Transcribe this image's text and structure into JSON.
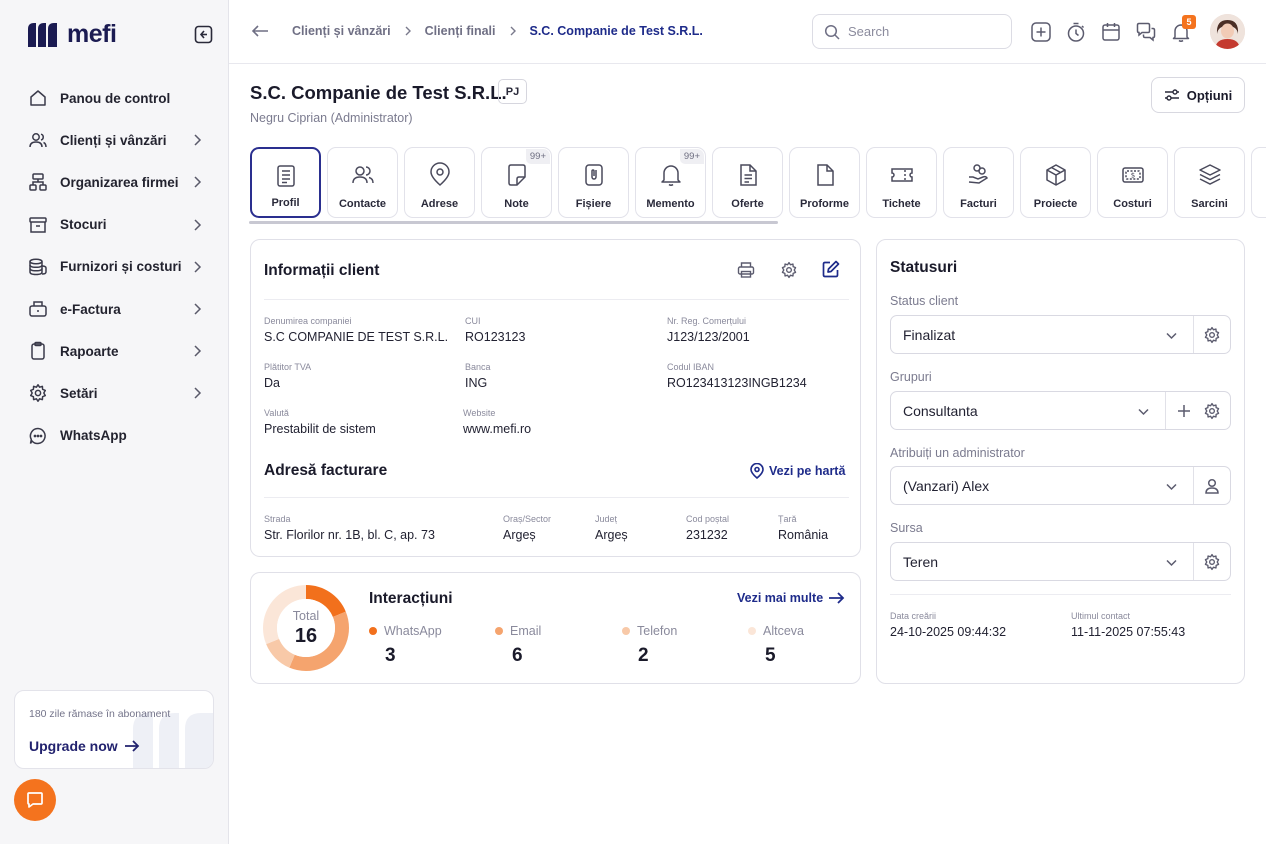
{
  "app": {
    "logo_text": "mefi",
    "brand_color": "#1b1b52",
    "accent_color": "#f4731e"
  },
  "sidebar": {
    "items": [
      {
        "label": "Panou de control",
        "icon": "home-icon",
        "has_chevron": false
      },
      {
        "label": "Clienți și vânzări",
        "icon": "users-icon",
        "has_chevron": true
      },
      {
        "label": "Organizarea firmei",
        "icon": "org-chart-icon",
        "has_chevron": true
      },
      {
        "label": "Stocuri",
        "icon": "archive-box-icon",
        "has_chevron": true
      },
      {
        "label": "Furnizori și costuri",
        "icon": "coins-icon",
        "has_chevron": true
      },
      {
        "label": "e-Factura",
        "icon": "invoice-box-icon",
        "has_chevron": true
      },
      {
        "label": "Rapoarte",
        "icon": "clipboard-icon",
        "has_chevron": true
      },
      {
        "label": "Setări",
        "icon": "gear-icon",
        "has_chevron": true
      },
      {
        "label": "WhatsApp",
        "icon": "chat-bubble-icon",
        "has_chevron": false
      }
    ],
    "upgrade": {
      "note": "180 zile rămase în abonament",
      "link": "Upgrade now"
    }
  },
  "topbar": {
    "breadcrumbs": [
      "Clienți și vânzări",
      "Clienți finali",
      "S.C. Companie de Test S.R.L."
    ],
    "search_placeholder": "Search",
    "notifications_count": "5"
  },
  "header": {
    "company_name": "S.C. Companie de Test S.R.L.",
    "type_badge": "PJ",
    "owner": "Negru Ciprian (Administrator)",
    "options_label": "Opțiuni"
  },
  "tabs": [
    {
      "label": "Profil",
      "icon": "document-lines-icon",
      "count": ""
    },
    {
      "label": "Contacte",
      "icon": "users-icon",
      "count": ""
    },
    {
      "label": "Adrese",
      "icon": "map-pin-icon",
      "count": ""
    },
    {
      "label": "Note",
      "icon": "note-icon",
      "count": "99+"
    },
    {
      "label": "Fișiere",
      "icon": "paperclip-file-icon",
      "count": ""
    },
    {
      "label": "Memento",
      "icon": "bell-icon",
      "count": "99+"
    },
    {
      "label": "Oferte",
      "icon": "document-text-icon",
      "count": ""
    },
    {
      "label": "Proforme",
      "icon": "document-blank-icon",
      "count": ""
    },
    {
      "label": "Tichete",
      "icon": "ticket-icon",
      "count": ""
    },
    {
      "label": "Facturi",
      "icon": "hand-coins-icon",
      "count": ""
    },
    {
      "label": "Proiecte",
      "icon": "cube-icon",
      "count": ""
    },
    {
      "label": "Costuri",
      "icon": "money-bill-icon",
      "count": ""
    },
    {
      "label": "Sarcini",
      "icon": "layers-icon",
      "count": ""
    }
  ],
  "client_info": {
    "title": "Informații client",
    "fields": [
      {
        "label": "Denumirea companiei",
        "value": "S.C COMPANIE DE TEST S.R.L."
      },
      {
        "label": "CUI",
        "value": "RO123123"
      },
      {
        "label": "Nr. Reg. Comerțului",
        "value": "J123/123/2001"
      },
      {
        "label": "Plătitor TVA",
        "value": "Da"
      },
      {
        "label": "Banca",
        "value": "ING"
      },
      {
        "label": "Codul IBAN",
        "value": "RO123413123INGB1234"
      },
      {
        "label": "Valută",
        "value": "Prestabilit de sistem"
      },
      {
        "label": "Website",
        "value": "www.mefi.ro"
      }
    ],
    "billing_title": "Adresă facturare",
    "map_link": "Vezi pe hartă",
    "address": [
      {
        "label": "Strada",
        "value": "Str. Florilor nr. 1B, bl. C, ap. 73"
      },
      {
        "label": "Oraș/Sector",
        "value": "Argeș"
      },
      {
        "label": "Județ",
        "value": "Argeș"
      },
      {
        "label": "Cod poștal",
        "value": "231232"
      },
      {
        "label": "Țară",
        "value": "România"
      }
    ]
  },
  "interactions": {
    "title": "Interacțiuni",
    "more_link": "Vezi mai multe",
    "total_label": "Total",
    "total_value": "16",
    "items": [
      {
        "label": "WhatsApp",
        "value": "3",
        "color": "#f2701c"
      },
      {
        "label": "Email",
        "value": "6",
        "color": "#f5a46e"
      },
      {
        "label": "Telefon",
        "value": "2",
        "color": "#f8c9a8"
      },
      {
        "label": "Altceva",
        "value": "5",
        "color": "#fbe6d8"
      }
    ]
  },
  "statuses": {
    "title": "Statusuri",
    "fields": [
      {
        "label": "Status client",
        "value": "Finalizat"
      },
      {
        "label": "Grupuri",
        "value": "Consultanta"
      },
      {
        "label": "Atribuiți un administrator",
        "value": "(Vanzari) Alex"
      },
      {
        "label": "Sursa",
        "value": "Teren"
      }
    ],
    "created_label": "Data creării",
    "created_value": "24-10-2025 09:44:32",
    "last_contact_label": "Ultimul contact",
    "last_contact_value": "11-11-2025 07:55:43"
  }
}
